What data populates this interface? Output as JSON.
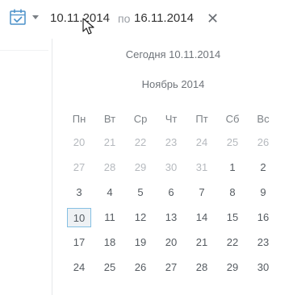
{
  "date_range": {
    "from": "10.11.2014",
    "separator": "по",
    "to": "16.11.2014",
    "clear_symbol": "✕"
  },
  "calendar": {
    "today_label": "Сегодня 10.11.2014",
    "month_label": "Ноябрь 2014",
    "weekdays": [
      "Пн",
      "Вт",
      "Ср",
      "Чт",
      "Пт",
      "Сб",
      "Вс"
    ],
    "weeks": [
      [
        {
          "d": "20",
          "other": true
        },
        {
          "d": "21",
          "other": true
        },
        {
          "d": "22",
          "other": true
        },
        {
          "d": "23",
          "other": true
        },
        {
          "d": "24",
          "other": true
        },
        {
          "d": "25",
          "other": true
        },
        {
          "d": "26",
          "other": true
        }
      ],
      [
        {
          "d": "27",
          "other": true
        },
        {
          "d": "28",
          "other": true
        },
        {
          "d": "29",
          "other": true
        },
        {
          "d": "30",
          "other": true
        },
        {
          "d": "31",
          "other": true
        },
        {
          "d": "1",
          "other": false
        },
        {
          "d": "2",
          "other": false
        }
      ],
      [
        {
          "d": "3",
          "other": false
        },
        {
          "d": "4",
          "other": false
        },
        {
          "d": "5",
          "other": false
        },
        {
          "d": "6",
          "other": false
        },
        {
          "d": "7",
          "other": false
        },
        {
          "d": "8",
          "other": false
        },
        {
          "d": "9",
          "other": false
        }
      ],
      [
        {
          "d": "10",
          "other": false,
          "selected": true
        },
        {
          "d": "11",
          "other": false
        },
        {
          "d": "12",
          "other": false
        },
        {
          "d": "13",
          "other": false
        },
        {
          "d": "14",
          "other": false
        },
        {
          "d": "15",
          "other": false
        },
        {
          "d": "16",
          "other": false
        }
      ],
      [
        {
          "d": "17",
          "other": false
        },
        {
          "d": "18",
          "other": false
        },
        {
          "d": "19",
          "other": false
        },
        {
          "d": "20",
          "other": false
        },
        {
          "d": "21",
          "other": false
        },
        {
          "d": "22",
          "other": false
        },
        {
          "d": "23",
          "other": false
        }
      ],
      [
        {
          "d": "24",
          "other": false
        },
        {
          "d": "25",
          "other": false
        },
        {
          "d": "26",
          "other": false
        },
        {
          "d": "27",
          "other": false
        },
        {
          "d": "28",
          "other": false
        },
        {
          "d": "29",
          "other": false
        },
        {
          "d": "30",
          "other": false
        }
      ]
    ]
  },
  "colors": {
    "icon": "#4a90c8",
    "selected_border": "#85c0e3",
    "selected_bg": "#eef1f4"
  }
}
